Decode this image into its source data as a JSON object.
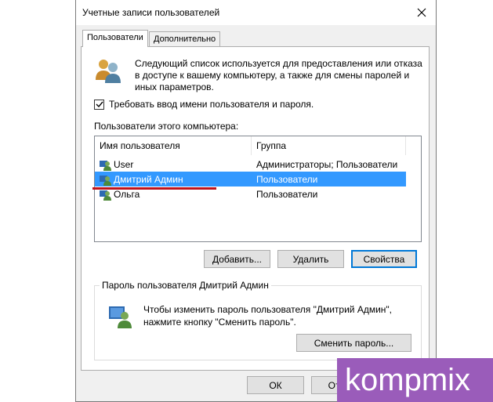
{
  "window": {
    "title": "Учетные записи пользователей",
    "close_glyph": "×"
  },
  "tabs": [
    {
      "label": "Пользователи",
      "active": true
    },
    {
      "label": "Дополнительно",
      "active": false
    }
  ],
  "panel": {
    "description": "Следующий список используется для предоставления или отказа в доступе к вашему компьютеру, а также для смены паролей и иных параметров.",
    "require_login_label": "Требовать ввод имени пользователя и пароля.",
    "require_login_checked": true,
    "list_label": "Пользователи этого компьютера:"
  },
  "users_table": {
    "columns": [
      "Имя пользователя",
      "Группа"
    ],
    "rows": [
      {
        "name": "User",
        "group": "Администраторы; Пользователи",
        "selected": false
      },
      {
        "name": "Дмитрий Админ",
        "group": "Пользователи",
        "selected": true
      },
      {
        "name": "Ольга",
        "group": "Пользователи",
        "selected": false
      }
    ]
  },
  "buttons": {
    "add": "Добавить...",
    "remove": "Удалить",
    "properties": "Свойства",
    "change_password": "Сменить пароль...",
    "ok": "ОК",
    "cancel": "Отме"
  },
  "password_group": {
    "title": "Пароль пользователя Дмитрий Админ",
    "text": "Чтобы изменить пароль пользователя \"Дмитрий Админ\", нажмите кнопку \"Сменить пароль\"."
  },
  "watermark": {
    "text": "kompmix"
  },
  "colors": {
    "selection": "#3399ff",
    "highlight_underline": "#c0141c",
    "default_button_border": "#0078d7",
    "watermark_bg": "#9a5cba"
  }
}
